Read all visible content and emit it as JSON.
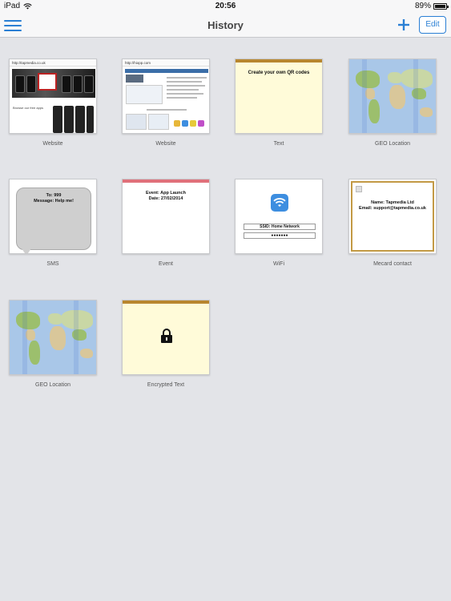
{
  "status_bar": {
    "device": "iPad",
    "time": "20:56",
    "battery": "89%",
    "battery_level": 0.89
  },
  "nav": {
    "title": "History",
    "add_icon": "plus-icon",
    "edit_label": "Edit",
    "menu_icon": "hamburger-menu-icon"
  },
  "items": [
    {
      "label": "Website",
      "type": "website",
      "url": "http://tapmedia.co.uk",
      "line": "Browse our free apps"
    },
    {
      "label": "Website",
      "type": "website",
      "url": "http://hiopp.com"
    },
    {
      "label": "Text",
      "type": "text",
      "content": "Create your own QR codes"
    },
    {
      "label": "GEO Location",
      "type": "geo"
    },
    {
      "label": "SMS",
      "type": "sms",
      "to": "To: 999",
      "message": "Message: Help me!"
    },
    {
      "label": "Event",
      "type": "event",
      "event": "Event: App Launch",
      "date": "Date: 27/02/2014"
    },
    {
      "label": "WiFi",
      "type": "wifi",
      "ssid": "SSID: Home Network",
      "password": "●●●●●●●"
    },
    {
      "label": "Mecard contact",
      "type": "mecard",
      "name": "Name: Tapmedia Ltd",
      "email": "Email: support@tapmedia.co.uk"
    },
    {
      "label": "GEO Location",
      "type": "geo"
    },
    {
      "label": "Encrypted Text",
      "type": "encrypted"
    }
  ],
  "colors": {
    "accent": "#2a7fd4",
    "background": "#e3e4e8"
  }
}
